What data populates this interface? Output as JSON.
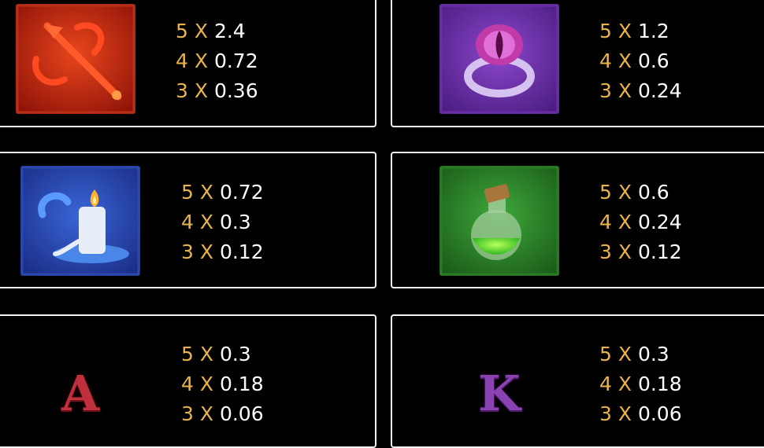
{
  "paytable": [
    {
      "symbol": "red-trident",
      "icon": "trident-icon",
      "color": "#c0241a",
      "pays": [
        {
          "count": "5",
          "x": "X",
          "value": "2.4"
        },
        {
          "count": "4",
          "x": "X",
          "value": "0.72"
        },
        {
          "count": "3",
          "x": "X",
          "value": "0.36"
        }
      ]
    },
    {
      "symbol": "purple-eye-ring",
      "icon": "eye-ring-icon",
      "color": "#7a35b8",
      "pays": [
        {
          "count": "5",
          "x": "X",
          "value": "1.2"
        },
        {
          "count": "4",
          "x": "X",
          "value": "0.6"
        },
        {
          "count": "3",
          "x": "X",
          "value": "0.24"
        }
      ]
    },
    {
      "symbol": "blue-candle",
      "icon": "candle-icon",
      "color": "#2947b0",
      "pays": [
        {
          "count": "5",
          "x": "X",
          "value": "0.72"
        },
        {
          "count": "4",
          "x": "X",
          "value": "0.3"
        },
        {
          "count": "3",
          "x": "X",
          "value": "0.12"
        }
      ]
    },
    {
      "symbol": "green-potion",
      "icon": "potion-icon",
      "color": "#2f8f2c",
      "pays": [
        {
          "count": "5",
          "x": "X",
          "value": "0.6"
        },
        {
          "count": "4",
          "x": "X",
          "value": "0.24"
        },
        {
          "count": "3",
          "x": "X",
          "value": "0.12"
        }
      ]
    },
    {
      "symbol": "A",
      "icon": "letter-a-icon",
      "color": "#c0303c",
      "letter": "A",
      "pays": [
        {
          "count": "5",
          "x": "X",
          "value": "0.3"
        },
        {
          "count": "4",
          "x": "X",
          "value": "0.18"
        },
        {
          "count": "3",
          "x": "X",
          "value": "0.06"
        }
      ]
    },
    {
      "symbol": "K",
      "icon": "letter-k-icon",
      "color": "#8a42b0",
      "letter": "K",
      "pays": [
        {
          "count": "5",
          "x": "X",
          "value": "0.3"
        },
        {
          "count": "4",
          "x": "X",
          "value": "0.18"
        },
        {
          "count": "3",
          "x": "X",
          "value": "0.06"
        }
      ]
    }
  ],
  "colors": {
    "multiplier": "#e8b44a",
    "value": "#ffffff",
    "border": "#f2f2f2"
  }
}
